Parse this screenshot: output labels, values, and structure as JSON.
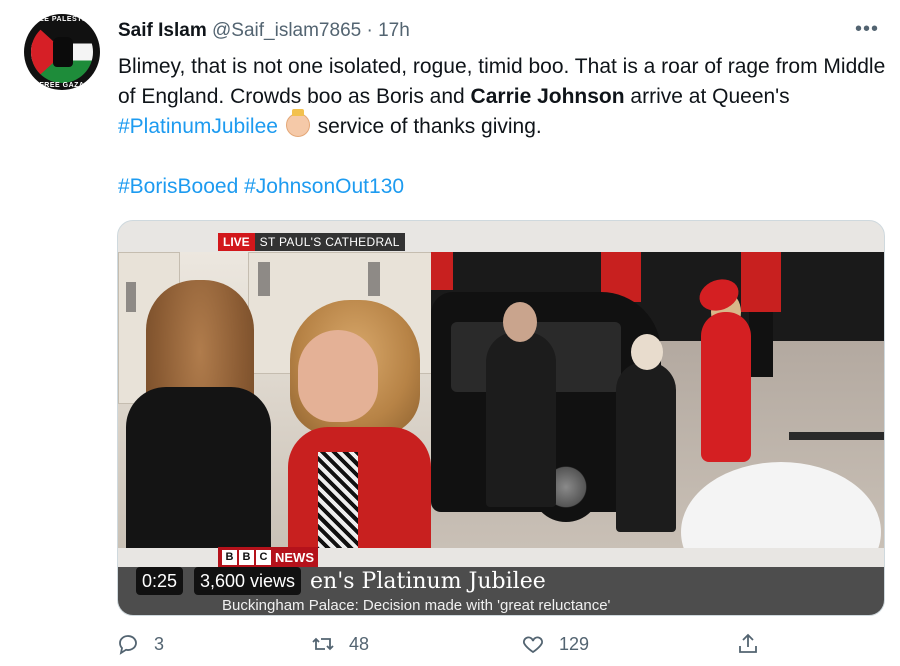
{
  "tweet": {
    "author_name": "Saif Islam",
    "author_handle": "@Saif_islam7865",
    "separator": "·",
    "time": "17h",
    "more_icon": "more-icon",
    "text_part1": "Blimey, that is not one isolated, rogue, timid boo. That is a roar of rage from Middle of England. Crowds boo as Boris and ",
    "text_bold": "Carrie Johnson",
    "text_part2": " arrive at Queen's ",
    "hashtag_platinum": "#PlatinumJubilee",
    "text_part3": " service of thanks giving.",
    "hashtag_boris": "#BorisBooed",
    "hashtag_johnson": "#JohnsonOut130",
    "avatar": {
      "text_top": "FREE PALESTINE",
      "text_bottom": "FREE GAZA",
      "colors": {
        "black": "#111111",
        "white": "#f4f4f4",
        "green": "#1e8c3a",
        "red": "#d61f26"
      }
    }
  },
  "video": {
    "live_label": "LIVE",
    "live_location": "ST PAUL'S CATHEDRAL",
    "bbc_letters": [
      "B",
      "B",
      "C"
    ],
    "bbc_news_label": "NEWS",
    "headline": "en's Platinum Jubilee",
    "ticker": "Buckingham Palace: Decision made with 'great reluctance'",
    "duration": "0:25",
    "views": "3,600 views"
  },
  "actions": {
    "reply_count": "3",
    "retweet_count": "48",
    "like_count": "129",
    "icons": [
      "reply-icon",
      "retweet-icon",
      "like-icon",
      "share-icon"
    ]
  },
  "colors": {
    "link": "#1d9bf0",
    "text": "#0f1419",
    "secondary": "#536471",
    "bbc_red": "#b5121b",
    "live_red": "#d2171b"
  }
}
